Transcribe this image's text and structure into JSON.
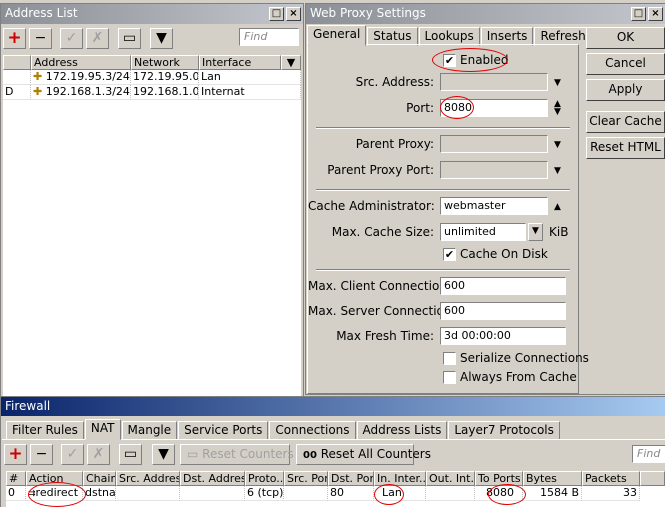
{
  "address_list": {
    "title": "Address List",
    "find_placeholder": "Find",
    "columns": [
      "Address",
      "Network",
      "Interface"
    ],
    "rows": [
      {
        "flag": "",
        "address": "172.19.95.3/24",
        "network": "172.19.95.0",
        "interface": "Lan"
      },
      {
        "flag": "D",
        "address": "192.168.1.3/24",
        "network": "192.168.1.0",
        "interface": "Internat"
      }
    ]
  },
  "proxy": {
    "title": "Web Proxy Settings",
    "tabs": [
      "General",
      "Status",
      "Lookups",
      "Inserts",
      "Refreshes"
    ],
    "enabled_label": "Enabled",
    "src_address_label": "Src. Address:",
    "src_address": "",
    "port_label": "Port:",
    "port": "8080",
    "parent_proxy_label": "Parent Proxy:",
    "parent_proxy": "",
    "parent_proxy_port_label": "Parent Proxy Port:",
    "parent_proxy_port": "",
    "cache_admin_label": "Cache Administrator:",
    "cache_admin": "webmaster",
    "max_cache_size_label": "Max. Cache Size:",
    "max_cache_size": "unlimited",
    "max_cache_unit": "KiB",
    "cache_on_disk_label": "Cache On Disk",
    "max_client_conn_label": "Max. Client Connections:",
    "max_client_conn": "600",
    "max_server_conn_label": "Max. Server Connections:",
    "max_server_conn": "600",
    "max_fresh_time_label": "Max Fresh Time:",
    "max_fresh_time": "3d 00:00:00",
    "serialize_conn_label": "Serialize Connections",
    "always_from_cache_label": "Always From Cache",
    "buttons": {
      "ok": "OK",
      "cancel": "Cancel",
      "apply": "Apply",
      "clear_cache": "Clear Cache",
      "reset_html": "Reset HTML"
    }
  },
  "firewall": {
    "title": "Firewall",
    "tabs": [
      "Filter Rules",
      "NAT",
      "Mangle",
      "Service Ports",
      "Connections",
      "Address Lists",
      "Layer7 Protocols"
    ],
    "reset_counters": "Reset Counters",
    "reset_all_counters": "Reset All Counters",
    "reset_all_prefix": "00",
    "find_placeholder": "Find",
    "columns": [
      "#",
      "Action",
      "Chain",
      "Src. Address",
      "Dst. Address",
      "Proto...",
      "Src. Port",
      "Dst. Port",
      "In. Inter...",
      "Out. Int...",
      "To Ports",
      "Bytes",
      "Packets"
    ],
    "rows": [
      {
        "num": "0",
        "action": "redirect",
        "chain": "dstnat",
        "src_address": "",
        "dst_address": "",
        "proto": "6 (tcp)",
        "src_port": "",
        "dst_port": "80",
        "in_iface": "Lan",
        "out_iface": "",
        "to_ports": "8080",
        "bytes": "1584 B",
        "packets": "33"
      }
    ]
  }
}
